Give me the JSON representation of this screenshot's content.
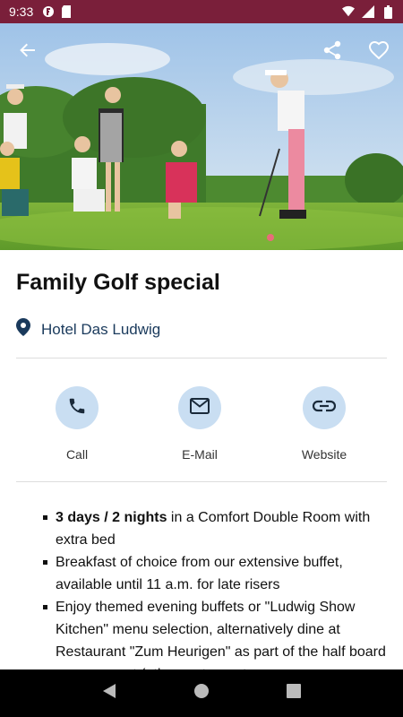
{
  "status_bar": {
    "time": "9:33",
    "icons": [
      "app-notification-icon",
      "sd-card-icon",
      "wifi-icon",
      "signal-icon",
      "battery-icon"
    ],
    "color": "#7a1f3a"
  },
  "header": {
    "back_icon": "arrow-back-icon",
    "share_icon": "share-icon",
    "favorite_icon": "heart-outline-icon"
  },
  "offer": {
    "title": "Family Golf special",
    "location_icon": "location-pin-icon",
    "location": "Hotel Das Ludwig"
  },
  "actions": [
    {
      "icon": "phone-icon",
      "label": "Call"
    },
    {
      "icon": "mail-icon",
      "label": "E-Mail"
    },
    {
      "icon": "link-icon",
      "label": "Website"
    }
  ],
  "description": {
    "items": [
      {
        "bold": "3 days / 2 nights",
        "text": " in a Comfort Double Room with extra bed"
      },
      {
        "bold": "",
        "text": "Breakfast of choice from our extensive buffet, available until 11 a.m. for late risers"
      },
      {
        "bold": "",
        "text": "Enjoy themed evening buffets or \"Ludwig Show Kitchen\" menu selection, alternatively dine at Restaurant \"Zum Heurigen\" as part of the half board arrangement (other restaurants ma"
      }
    ]
  },
  "colors": {
    "accent_circle": "#c9def2",
    "icon_dark": "#1a2a3a",
    "location_text": "#1a3a5c"
  },
  "nav_bar": {
    "icons": [
      "nav-back-icon",
      "nav-home-icon",
      "nav-recents-icon"
    ]
  }
}
